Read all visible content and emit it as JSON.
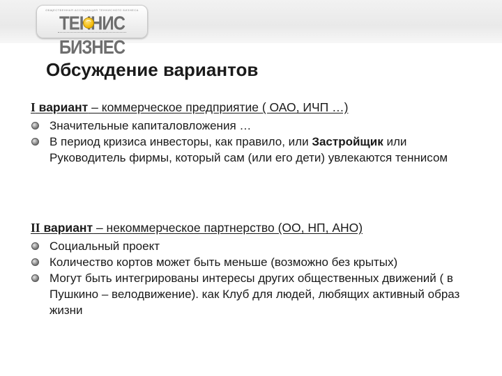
{
  "logo": {
    "text": "ТЕННИС БИЗНЕС",
    "tagline": "ОБЩЕСТВЕННАЯ АССОЦИАЦИЯ ТЕННИСНОГО БИЗНЕСА"
  },
  "title": "Обсуждение вариантов",
  "sections": [
    {
      "numeral": "I",
      "label": " вариант",
      "rest": " – коммерческое предприятие ( ОАО, ИЧП …)",
      "items": [
        {
          "text": "Значительные капиталовложения …"
        },
        {
          "pre": "В период кризиса инвесторы, как правило, или ",
          "bold": "Застройщик",
          "post": " или Руководитель фирмы, который сам (или его дети) увлекаются теннисом"
        }
      ]
    },
    {
      "numeral": "II",
      "label": " вариант",
      "rest": " – некоммерческое партнерство (ОО, НП, АНО)",
      "items": [
        {
          "text": "Социальный проект"
        },
        {
          "text": "Количество кортов может быть меньше (возможно без крытых)"
        },
        {
          "text": "Могут быть интегрированы интересы других общественных движений ( в Пушкино – велодвижение). как Клуб для людей, любящих активный образ жизни"
        }
      ]
    }
  ]
}
